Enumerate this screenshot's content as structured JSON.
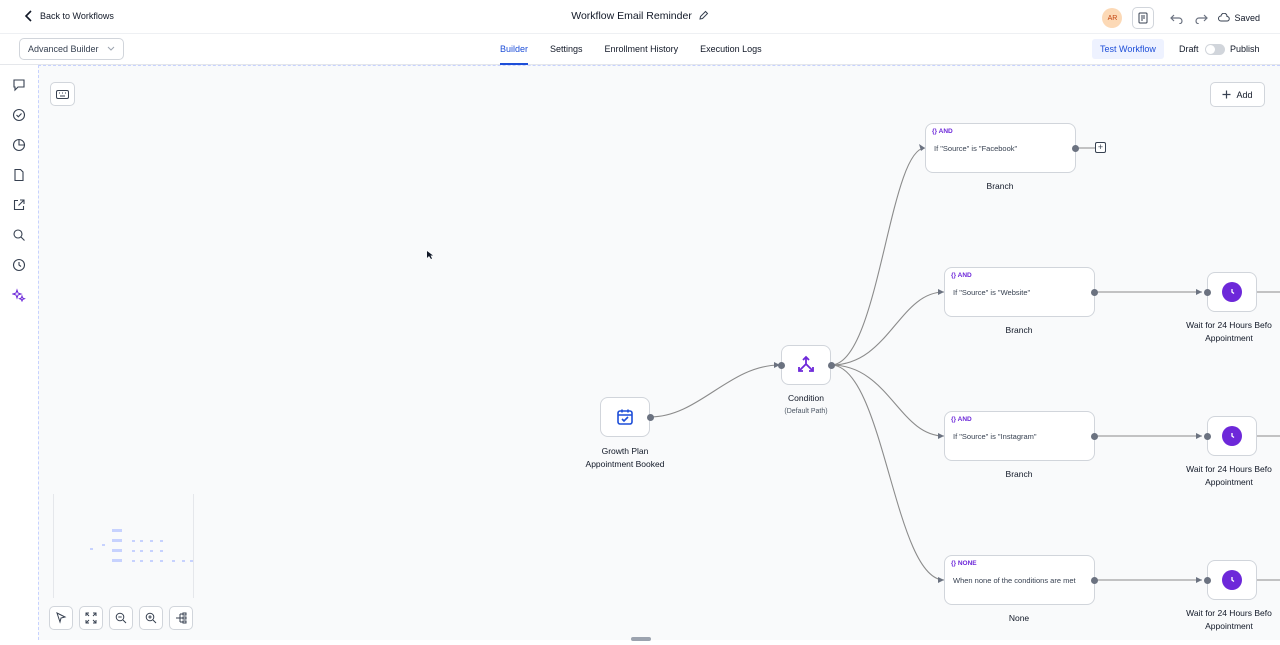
{
  "header": {
    "back_label": "Back to Workflows",
    "title": "Workflow Email Reminder",
    "avatar_initials": "AR",
    "saved_label": "Saved"
  },
  "subbar": {
    "builder_mode": "Advanced Builder",
    "tabs": [
      {
        "label": "Builder",
        "active": true
      },
      {
        "label": "Settings",
        "active": false
      },
      {
        "label": "Enrollment History",
        "active": false
      },
      {
        "label": "Execution Logs",
        "active": false
      }
    ],
    "test_label": "Test Workflow",
    "draft_label": "Draft",
    "publish_label": "Publish",
    "published": false
  },
  "sidebar": {
    "icons": [
      "chat-icon",
      "check-circle-icon",
      "pie-chart-icon",
      "document-icon",
      "external-link-icon",
      "search-icon",
      "history-icon",
      "sparkle-icon"
    ]
  },
  "canvas": {
    "add_label": "Add",
    "trigger": {
      "line1": "Growth Plan",
      "line2": "Appointment Booked"
    },
    "condition": {
      "label": "Condition",
      "sub": "(Default Path)"
    },
    "branches": [
      {
        "tag": "{} AND",
        "text": "If \"Source\" is \"Facebook\"",
        "label": "Branch"
      },
      {
        "tag": "{} AND",
        "text": "If \"Source\" is \"Website\"",
        "label": "Branch"
      },
      {
        "tag": "{} AND",
        "text": "If \"Source\" is \"Instagram\"",
        "label": "Branch"
      },
      {
        "tag": "{} NONE",
        "text": "When none of the conditions are met",
        "label": "None"
      }
    ],
    "waits": [
      {
        "line1": "Wait for 24 Hours Befo",
        "line2": "Appointment"
      },
      {
        "line1": "Wait for 24 Hours Befo",
        "line2": "Appointment"
      },
      {
        "line1": "Wait for 24 Hours Befo",
        "line2": "Appointment"
      }
    ]
  },
  "colors": {
    "accent": "#1d4ed8",
    "purple": "#6d28d9",
    "edge": "#8b8b8b"
  }
}
